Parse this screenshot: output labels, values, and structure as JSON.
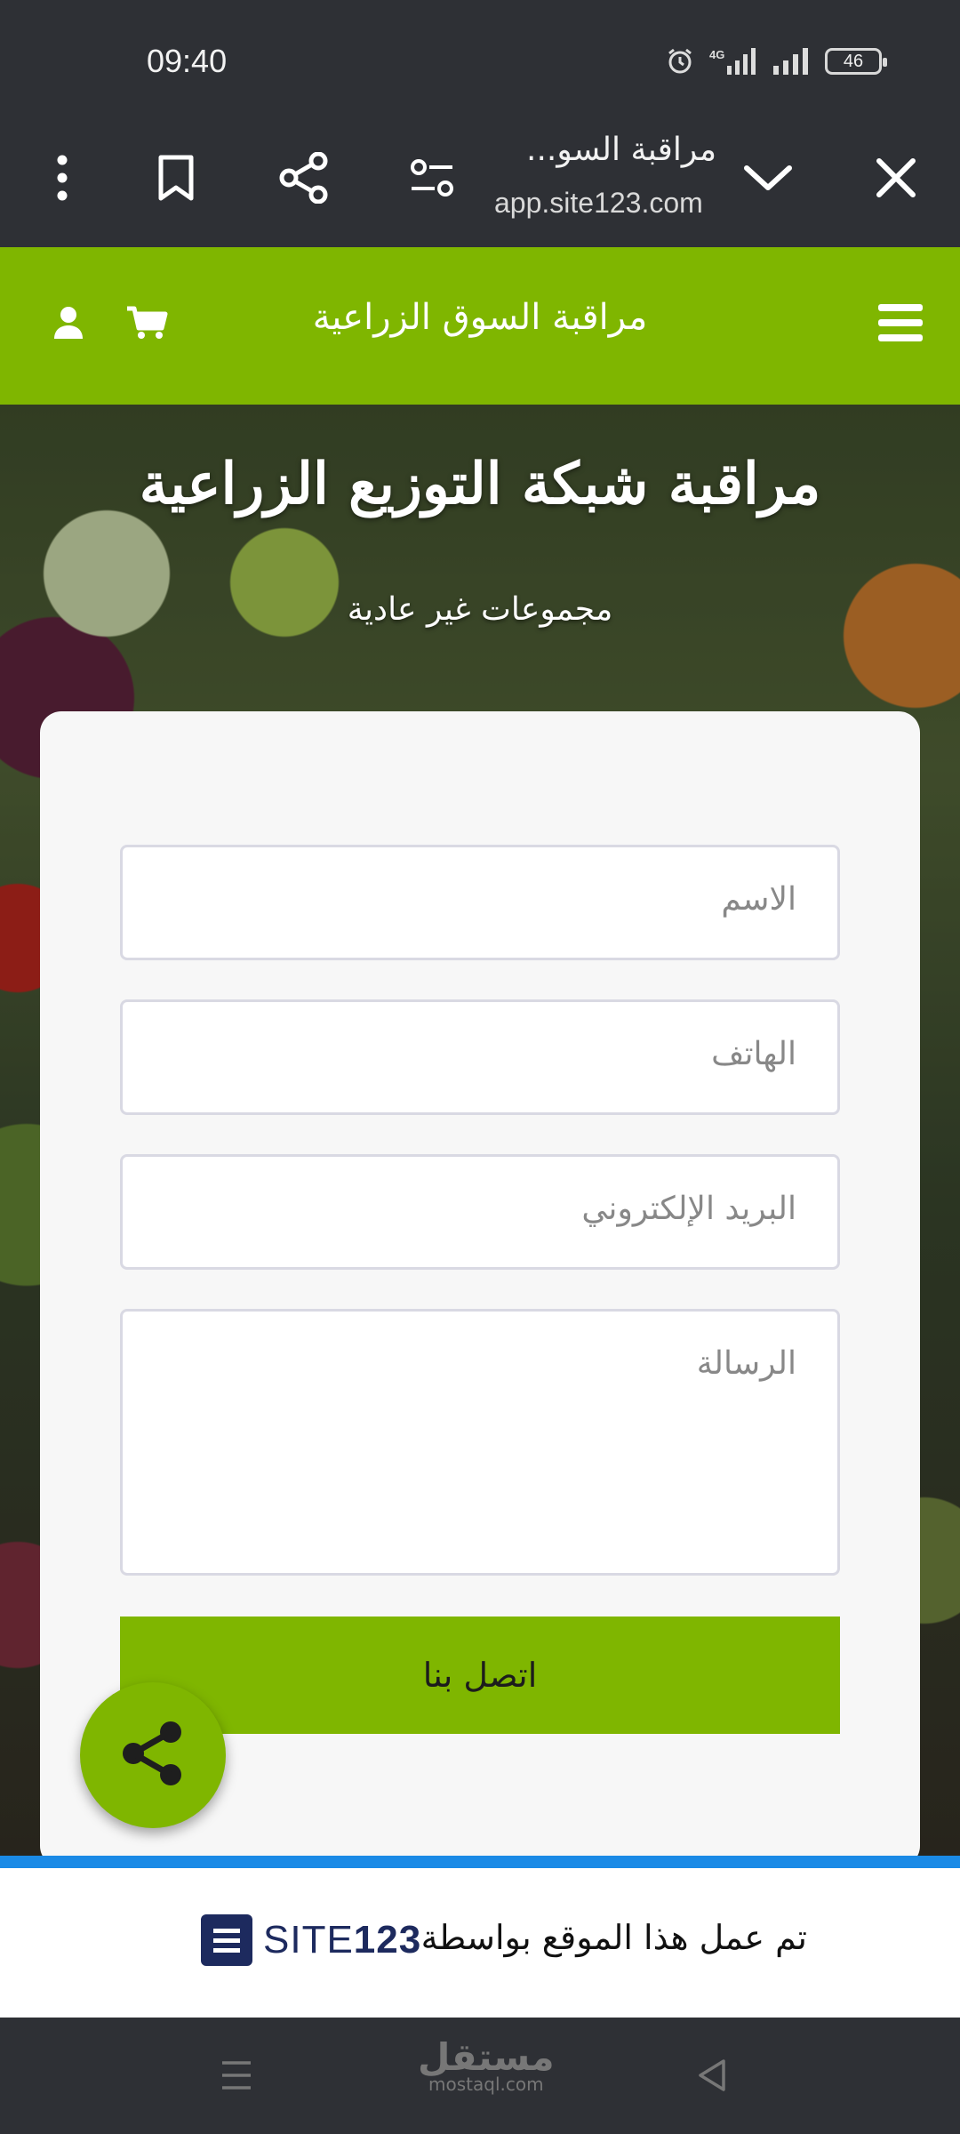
{
  "status_bar": {
    "time": "09:40",
    "network": "4G",
    "battery": "46",
    "icons": [
      "alarm-icon",
      "signal-4g-icon",
      "signal-icon",
      "battery-icon"
    ]
  },
  "browser": {
    "page_title": "مراقبة السو...",
    "url": "app.site123.com",
    "icons": [
      "menu-dots-icon",
      "bookmark-icon",
      "share-icon",
      "filter-icon",
      "chevron-down-icon",
      "close-icon"
    ]
  },
  "site": {
    "header_title": "مراقبة السوق الزراعية",
    "hero_title": "مراقبة شبكة التوزيع الزراعية",
    "hero_subtitle": "مجموعات غير عادية",
    "accent_color": "#7fb600"
  },
  "form": {
    "name_placeholder": "الاسم",
    "phone_placeholder": "الهاتف",
    "email_placeholder": "البريد الإلكتروني",
    "message_placeholder": "الرسالة",
    "submit_label": "اتصل بنا"
  },
  "footer": {
    "built_with": "تم عمل هذا الموقع بواسطة",
    "logo_site": "SITE",
    "logo_num": "123"
  },
  "navbar": {
    "watermark_ar": "مستقل",
    "watermark_en": "mostaql.com"
  }
}
